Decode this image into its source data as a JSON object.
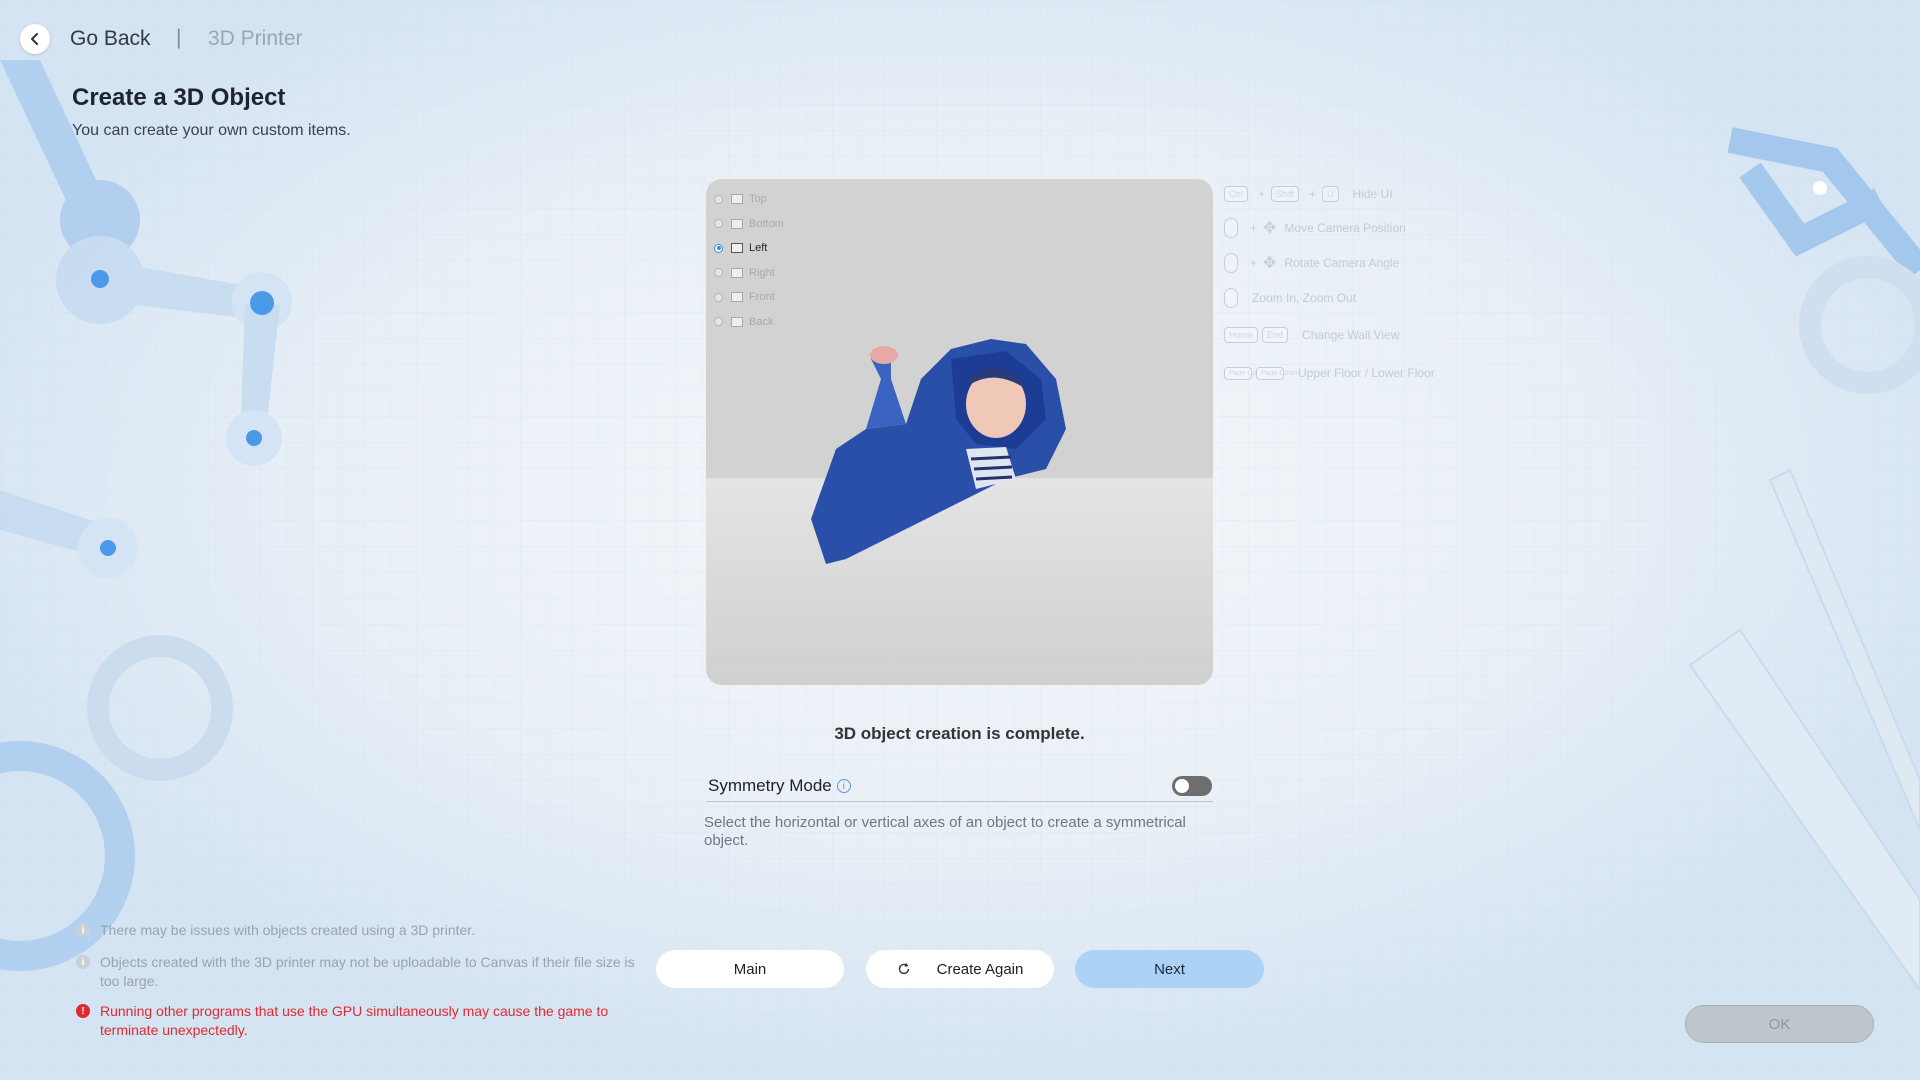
{
  "header": {
    "back_label": "Go Back",
    "separator": "|",
    "section": "3D Printer"
  },
  "page": {
    "title": "Create a 3D Object",
    "subtitle": "You can create your own custom items."
  },
  "preview": {
    "views": [
      {
        "label": "Top",
        "selected": false
      },
      {
        "label": "Bottom",
        "selected": false
      },
      {
        "label": "Left",
        "selected": true
      },
      {
        "label": "Right",
        "selected": false
      },
      {
        "label": "Front",
        "selected": false
      },
      {
        "label": "Back",
        "selected": false
      }
    ]
  },
  "shortcuts": {
    "hide_ui": {
      "keys": [
        "Ctrl",
        "Shift",
        "U"
      ],
      "label": "Hide UI"
    },
    "move_camera": {
      "label": "Move Camera Position"
    },
    "rotate_camera": {
      "label": "Rotate Camera Angle"
    },
    "zoom": {
      "label": "Zoom In, Zoom Out"
    },
    "wall_view": {
      "keys": [
        "Home",
        "End"
      ],
      "label": "Change Wall View"
    },
    "floor": {
      "keys": [
        "Page Up",
        "Page Down"
      ],
      "label": "Upper Floor / Lower Floor"
    }
  },
  "status": "3D object creation is complete.",
  "symmetry": {
    "label": "Symmetry Mode",
    "enabled": false,
    "description": "Select the horizontal or vertical axes of an object to create a symmetrical object."
  },
  "buttons": {
    "main": "Main",
    "create_again": "Create Again",
    "next": "Next",
    "ok": "OK"
  },
  "notices": [
    {
      "type": "info",
      "text": "There may be issues with objects created using a 3D printer."
    },
    {
      "type": "info",
      "text": "Objects created with the 3D printer may not be uploadable to Canvas if their file size is too large."
    },
    {
      "type": "warning",
      "text": "Running other programs that use the GPU simultaneously may cause the game to terminate unexpectedly."
    }
  ],
  "colors": {
    "accent": "#acd3f6",
    "warning": "#e2292f",
    "background": "#dbe8f4"
  }
}
